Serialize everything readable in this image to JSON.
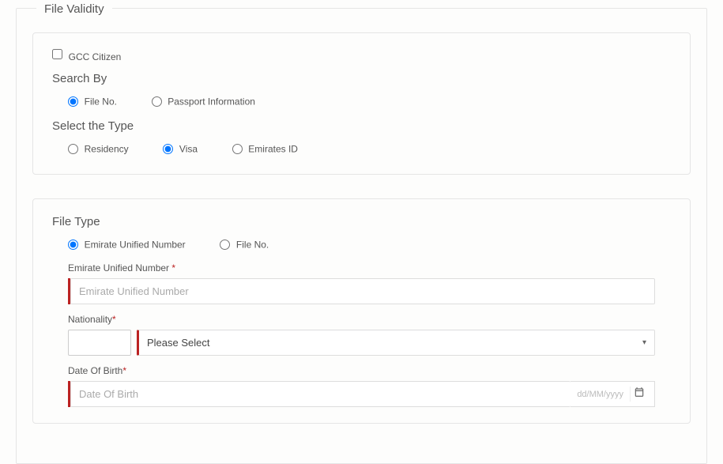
{
  "fieldset_title": "File Validity",
  "gcc_checkbox_label": "GCC Citizen",
  "search_by": {
    "heading": "Search By",
    "options": {
      "file_no": "File No.",
      "passport_info": "Passport Information"
    }
  },
  "select_type": {
    "heading": "Select the Type",
    "options": {
      "residency": "Residency",
      "visa": "Visa",
      "emirates_id": "Emirates ID"
    }
  },
  "file_type": {
    "heading": "File Type",
    "options": {
      "eun": "Emirate Unified Number",
      "file_no": "File No."
    }
  },
  "fields": {
    "eun_label": "Emirate Unified Number ",
    "eun_placeholder": "Emirate Unified Number",
    "nationality_label": "Nationality",
    "nationality_selected": "Please Select",
    "dob_label": "Date Of Birth",
    "dob_placeholder": "Date Of Birth",
    "dob_format_hint": "dd/MM/yyyy"
  },
  "required_mark": "*"
}
